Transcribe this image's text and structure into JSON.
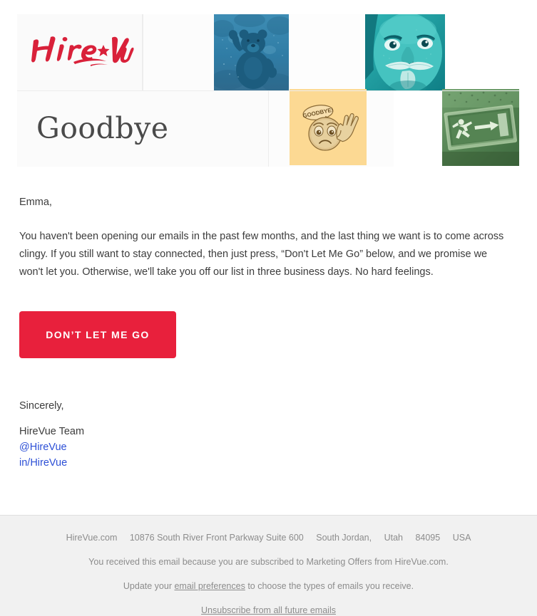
{
  "email": {
    "brand": "HireVue",
    "header": {
      "logo_text": "Hire★Vue",
      "headline": "Goodbye",
      "tiles": [
        {
          "name": "waving-bear",
          "alt": "Waving bear",
          "tint": "#2f7fa8"
        },
        {
          "name": "einstein-tongue",
          "alt": "Man sticking out tongue",
          "tint": "#1f9a9a"
        },
        {
          "name": "goodbye-emoji",
          "alt": "Sad emoji waving goodbye",
          "tint": "#fbd68a"
        },
        {
          "name": "exit-sign",
          "alt": "Emergency exit sign",
          "tint": "#5d8f5d"
        }
      ],
      "emoji_bubble_text": "GOODBYE!"
    },
    "body": {
      "salutation": "Emma,",
      "paragraph": "You haven't been opening our emails in the past few months, and the last thing we want is to come across clingy. If you still want to stay connected, then just press, “Don't Let Me Go” below, and we promise we won't let you. Otherwise, we'll take you off our list in three business days. No hard feelings."
    },
    "cta": {
      "label": "DON’T LET ME GO"
    },
    "signature": {
      "closing": "Sincerely,",
      "team": "HireVue Team",
      "twitter": "@HireVue",
      "linkedin": "in/HireVue"
    },
    "footer": {
      "site": "HireVue.com",
      "street": "10876 South River Front Parkway Suite 600",
      "city": "South Jordan,",
      "state": "Utah",
      "zip": "84095",
      "country": "USA",
      "subscription_notice": "You received this email because you are subscribed to Marketing Offers from HireVue.com.",
      "preferences_prefix": "Update your ",
      "preferences_link": "email preferences",
      "preferences_suffix": " to choose the types of emails you receive.",
      "unsubscribe_link": "Unsubscribe from all future emails"
    },
    "colors": {
      "brand_red": "#e8203c",
      "link_blue": "#2c4fd6",
      "footer_bg": "#f1f1f1",
      "text": "#3c3c3c"
    }
  }
}
